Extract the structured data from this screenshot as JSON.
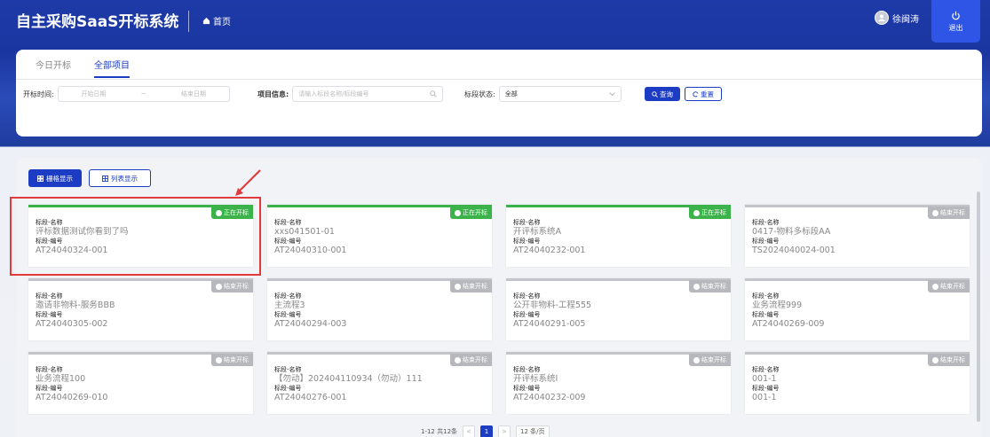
{
  "header": {
    "app_title": "自主采购SaaS开标系统",
    "home_label": "首页",
    "user_name": "徐闽涛",
    "logout_label": "退出"
  },
  "tabs": [
    {
      "label": "今日开标",
      "active": false
    },
    {
      "label": "全部项目",
      "active": true
    }
  ],
  "filters": {
    "time_label": "开标时间:",
    "start_placeholder": "开始日期",
    "range_sep": "~",
    "end_placeholder": "结束日期",
    "project_label": "项目信息:",
    "project_placeholder": "请输入标段名称/标段编号",
    "status_label": "标段状态:",
    "status_value": "全部",
    "query_label": "查询",
    "reset_label": "重置"
  },
  "view_toggle": {
    "grid_label": "栅格显示",
    "list_label": "列表显示"
  },
  "card_labels": {
    "name_label": "标段-名称",
    "code_label": "标段-编号"
  },
  "colors": {
    "primary": "#1c3cc4",
    "live": "#3cb34a",
    "ended": "#b6b8bd",
    "highlight": "#e03a3a"
  },
  "cards": [
    {
      "status": "正在开标",
      "live": true,
      "name": "评标数据测试你看到了吗",
      "code": "AT24040324-001"
    },
    {
      "status": "正在开标",
      "live": true,
      "name": "xxs041501-01",
      "code": "AT24040310-001"
    },
    {
      "status": "正在开标",
      "live": true,
      "name": "开评标系统A",
      "code": "AT24040232-001"
    },
    {
      "status": "结束开标",
      "live": false,
      "name": "0417-物料多标段AA",
      "code": "TS2024040024-001"
    },
    {
      "status": "结束开标",
      "live": false,
      "name": "邀请非物料-服务BBB",
      "code": "AT24040305-002"
    },
    {
      "status": "结束开标",
      "live": false,
      "name": "主流程3",
      "code": "AT24040294-003"
    },
    {
      "status": "结束开标",
      "live": false,
      "name": "公开非物料-工程555",
      "code": "AT24040291-005"
    },
    {
      "status": "结束开标",
      "live": false,
      "name": "业务流程999",
      "code": "AT24040269-009"
    },
    {
      "status": "结束开标",
      "live": false,
      "name": "业务流程100",
      "code": "AT24040269-010"
    },
    {
      "status": "结束开标",
      "live": false,
      "name": "【勿动】202404110934（勿动）111",
      "code": "AT24040276-001"
    },
    {
      "status": "结束开标",
      "live": false,
      "name": "开评标系统I",
      "code": "AT24040232-009"
    },
    {
      "status": "结束开标",
      "live": false,
      "name": "001-1",
      "code": "001-1"
    }
  ],
  "pagination": {
    "summary": "1-12 共12条",
    "prev": "<",
    "current_page": "1",
    "next": ">",
    "page_size": "12 条/页"
  }
}
